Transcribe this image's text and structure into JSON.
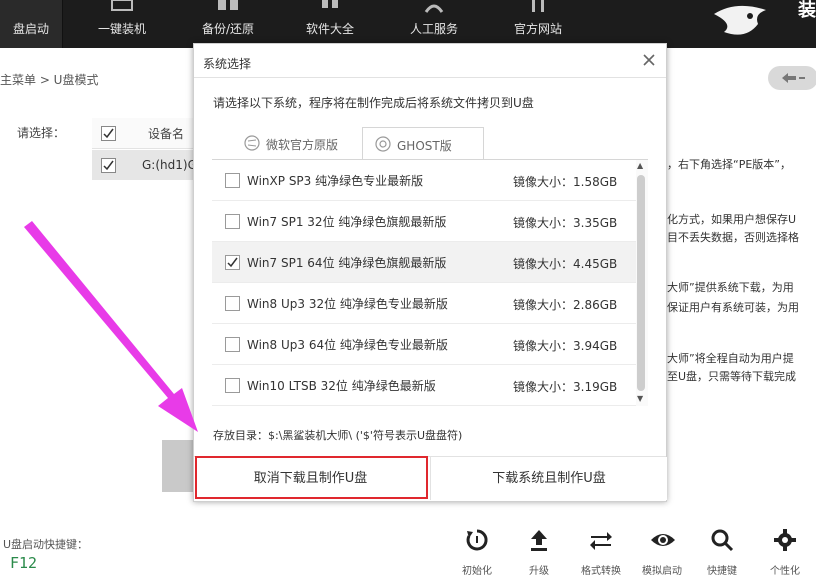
{
  "nav": {
    "items": [
      {
        "label": "盘启动",
        "icon": "usb-boot-icon"
      },
      {
        "label": "一键装机",
        "icon": "install-icon"
      },
      {
        "label": "备份/还原",
        "icon": "backup-icon"
      },
      {
        "label": "软件大全",
        "icon": "software-grid-icon"
      },
      {
        "label": "人工服务",
        "icon": "support-person-icon"
      },
      {
        "label": "官方网站",
        "icon": "website-icon"
      }
    ],
    "logo_text": "装"
  },
  "breadcrumb": "主菜单 > U盘模式",
  "left_panel": {
    "select_label": "请选择：",
    "device_col": "设备名",
    "device_value": "G:(hd1)G"
  },
  "right_texts": [
    "，右下角选择“PE版本”，",
    "化方式，如果用户想保存U",
    "目不丢失数据，否则选择格",
    "大师”提供系统下载，为用",
    "保证用户有系统可装，为用",
    "大师”将全程自动为用户提",
    "至U盘，只需等待下载完成"
  ],
  "footer": {
    "hotkey_label": "U盘启动快捷键：",
    "hotkey_value": "F12",
    "tools": [
      {
        "label": "初始化",
        "icon": "reset-icon"
      },
      {
        "label": "升级",
        "icon": "upload-icon"
      },
      {
        "label": "格式转换",
        "icon": "convert-icon"
      },
      {
        "label": "模拟启动",
        "icon": "eye-icon"
      },
      {
        "label": "快捷键",
        "icon": "search-icon"
      },
      {
        "label": "个性化",
        "icon": "gear-icon"
      }
    ]
  },
  "dialog": {
    "title": "系统选择",
    "intro": "请选择以下系统，程序将在制作完成后将系统文件拷贝到U盘",
    "tabs": [
      {
        "label": "微软官方原版",
        "active": false
      },
      {
        "label": "GHOST版",
        "active": true
      }
    ],
    "size_prefix": "镜像大小：",
    "systems": [
      {
        "name": "WinXP SP3 纯净绿色专业最新版",
        "size": "镜像大小：1.58GB",
        "checked": false
      },
      {
        "name": "Win7 SP1 32位 纯净绿色旗舰最新版",
        "size": "镜像大小：3.35GB",
        "checked": false
      },
      {
        "name": "Win7 SP1 64位 纯净绿色旗舰最新版",
        "size": "镜像大小：4.45GB",
        "checked": true
      },
      {
        "name": "Win8 Up3 32位 纯净绿色专业最新版",
        "size": "镜像大小：2.86GB",
        "checked": false
      },
      {
        "name": "Win8 Up3 64位 纯净绿色专业最新版",
        "size": "镜像大小：3.94GB",
        "checked": false
      },
      {
        "name": "Win10 LTSB 32位 纯净绿色最新版",
        "size": "镜像大小：3.19GB",
        "checked": false
      }
    ],
    "save_path": "存放目录：$:\\黑鲨装机大师\\ ('$'符号表示U盘盘符)",
    "cancel_button": "取消下载且制作U盘",
    "download_button": "下载系统且制作U盘"
  },
  "colors": {
    "topbar": "#1c1c1c",
    "highlight_box": "#e0282e",
    "arrow": "#e83be8",
    "hotkey": "#2a8a4a"
  }
}
